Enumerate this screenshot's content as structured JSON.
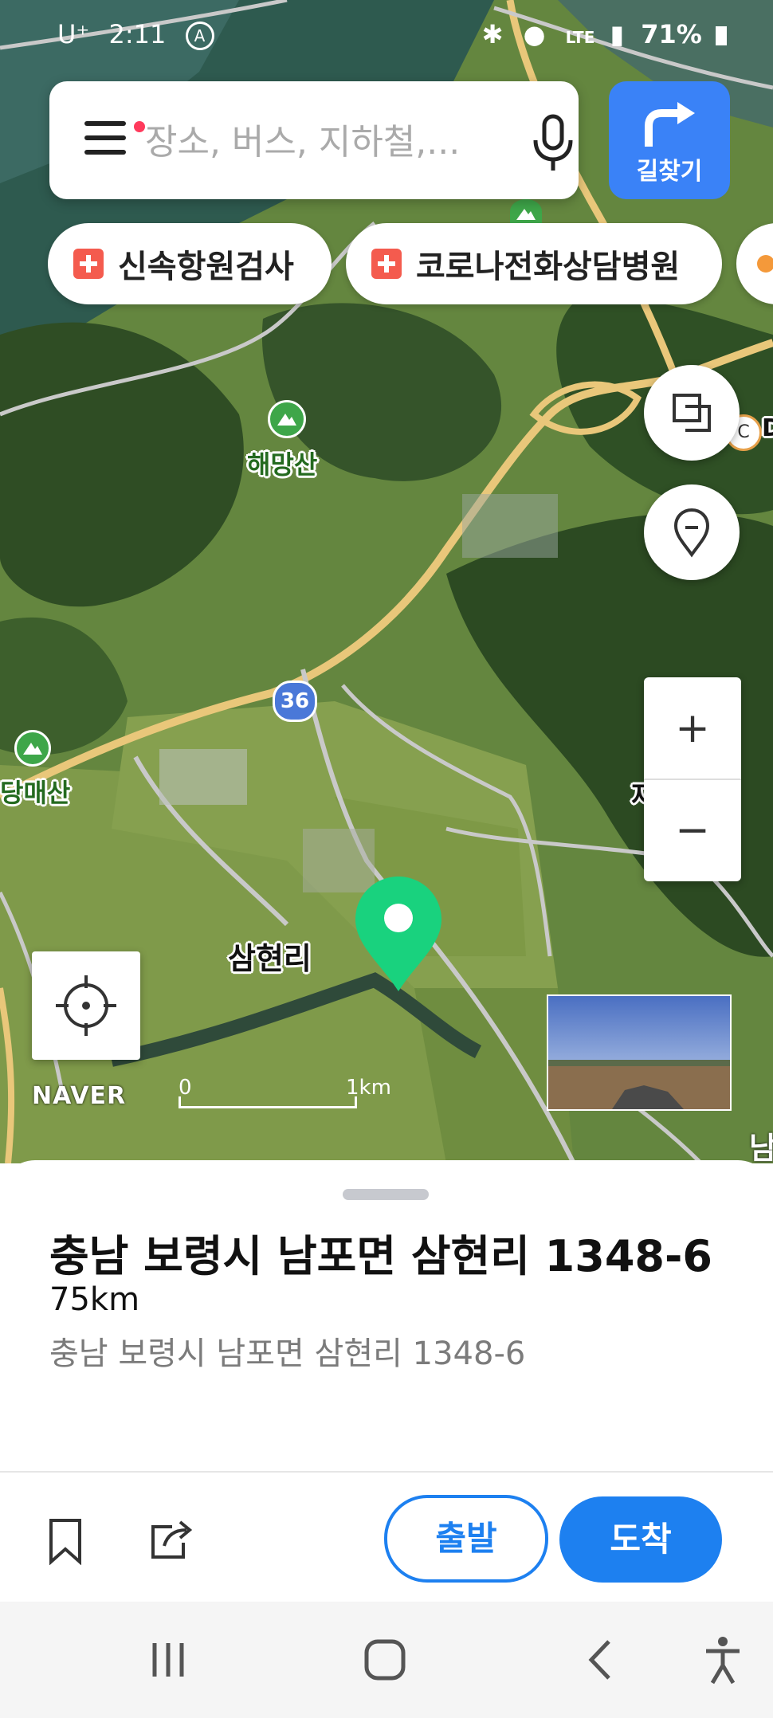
{
  "status_bar": {
    "carrier": "U⁺",
    "time": "2:11",
    "network": "LTE",
    "battery": "71%"
  },
  "search": {
    "placeholder": "장소, 버스, 지하철,..."
  },
  "directions_button": {
    "label": "길찾기"
  },
  "chips": [
    {
      "label": "신속항원검사",
      "icon": "medical-cross-icon"
    },
    {
      "label": "코로나전화상담병원",
      "icon": "medical-cross-icon"
    }
  ],
  "map": {
    "labels": {
      "mountain1": "해망산",
      "mountain2": "당매산",
      "village": "삼현리",
      "road_number": "36",
      "edge_label": "재",
      "edge_label2": "남",
      "edge_label3": "C",
      "edge_label4": "D"
    },
    "brand": "NAVER",
    "scale": {
      "start": "0",
      "end": "1km"
    },
    "zoom_in_label": "+",
    "zoom_out_label": "−"
  },
  "place": {
    "title": "충남 보령시 남포면 삼현리 1348-6",
    "distance": "75km",
    "address": "충남 보령시 남포면 삼현리 1348-6"
  },
  "actions": {
    "start_label": "출발",
    "arrive_label": "도착"
  },
  "colors": {
    "accent": "#1d80f0",
    "directions_bg": "#3a82f7",
    "marker": "#19d27e",
    "chip_icon": "#f45b4e"
  }
}
